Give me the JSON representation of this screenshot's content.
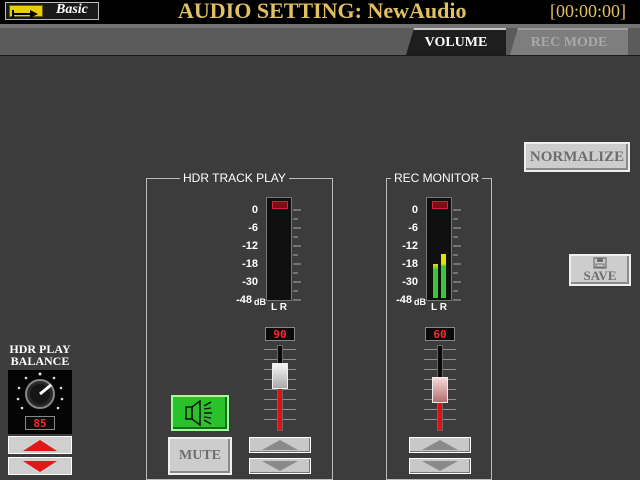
{
  "header": {
    "mode_label": "Basic",
    "title": "AUDIO SETTING: NewAudio",
    "time": "[00:00:00]"
  },
  "tabs": [
    {
      "label": "VOLUME",
      "active": true
    },
    {
      "label": "REC MODE",
      "active": false
    }
  ],
  "hdr_track_play": {
    "title": "HDR TRACK PLAY",
    "scale": [
      "0",
      "-6",
      "-12",
      "-18",
      "-30",
      "-48"
    ],
    "scale_unit": "dB",
    "lr_label": "L R",
    "level": "90",
    "mute_label": "MUTE"
  },
  "rec_monitor": {
    "title": "REC MONITOR",
    "scale": [
      "0",
      "-6",
      "-12",
      "-18",
      "-30",
      "-48"
    ],
    "scale_unit": "dB",
    "lr_label": "L R",
    "level": "60"
  },
  "balance": {
    "label_line1": "HDR PLAY",
    "label_line2": "BALANCE",
    "value": "85"
  },
  "buttons": {
    "normalize": "NORMALIZE",
    "save": "SAVE"
  },
  "colors": {
    "header_text": "#e0c060",
    "value_text": "#ff2a2a",
    "meter_green": "#38c838",
    "meter_yellow": "#e8e000",
    "fader_red": "#e01010"
  }
}
